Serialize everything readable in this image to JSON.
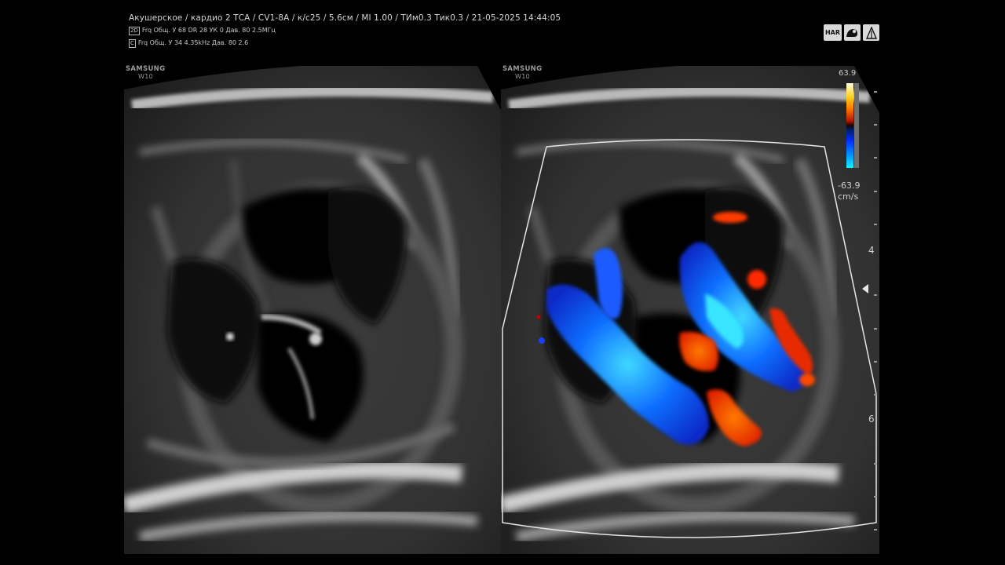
{
  "header": {
    "line1": "Акушерское / кардио 2 ТСА / CV1-8A / к/с25 / 5.6см / MI 1.00 / TИм0.3 Тик0.3 / 21-05-2025 14:44:05",
    "line2_tag": "2D",
    "line2": "Frq Общ.  У 68  DR 28  УК 0  Дав. 80  2.5МГц",
    "line3_tag": "C",
    "line3": "Frq Общ.  У 34  4.35kHz  Дав. 80  2.6"
  },
  "toolbar": {
    "button1_label": "HAR",
    "button2_icon": "fetal-heart-icon",
    "button3_icon": "body-marker-icon"
  },
  "brand": {
    "name": "SAMSUNG",
    "model": "W10"
  },
  "color_scale": {
    "top_value": "63.9",
    "bottom_value": "-63.9",
    "unit": "cm/s",
    "colors": {
      "positive": "#ffd21e",
      "negative": "#0030ff"
    }
  },
  "depth_labels": [
    "4",
    "6"
  ]
}
